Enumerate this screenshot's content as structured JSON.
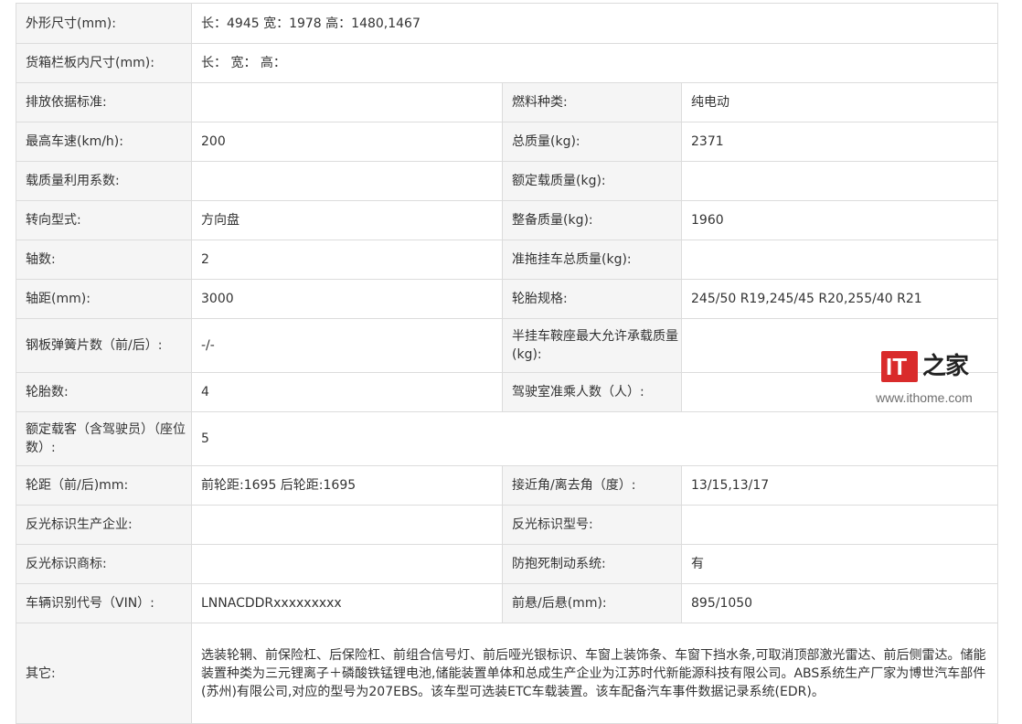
{
  "rows": [
    {
      "l1": "外形尺寸(mm):",
      "v1": "长：4945 宽：1978 高：1480,1467"
    },
    {
      "l1": "货箱栏板内尺寸(mm):",
      "v1": "长： 宽： 高："
    },
    {
      "l1": "排放依据标准:",
      "v1": "",
      "l2": "燃料种类:",
      "v2": "纯电动"
    },
    {
      "l1": "最高车速(km/h):",
      "v1": "200",
      "l2": "总质量(kg):",
      "v2": "2371"
    },
    {
      "l1": "载质量利用系数:",
      "v1": "",
      "l2": "额定载质量(kg):",
      "v2": ""
    },
    {
      "l1": "转向型式:",
      "v1": "方向盘",
      "l2": "整备质量(kg):",
      "v2": "1960"
    },
    {
      "l1": "轴数:",
      "v1": "2",
      "l2": "准拖挂车总质量(kg):",
      "v2": ""
    },
    {
      "l1": "轴距(mm):",
      "v1": "3000",
      "l2": "轮胎规格:",
      "v2": "245/50 R19,245/45 R20,255/40 R21"
    },
    {
      "l1": "钢板弹簧片数（前/后）:",
      "v1": "-/-",
      "l2": "半挂车鞍座最大允许承载质量(kg):",
      "v2": ""
    },
    {
      "l1": "轮胎数:",
      "v1": "4",
      "l2": "驾驶室准乘人数（人）:",
      "v2": ""
    },
    {
      "l1": "额定载客（含驾驶员）（座位数）:",
      "v1": "5"
    },
    {
      "l1": "轮距（前/后)mm:",
      "v1": "前轮距:1695 后轮距:1695",
      "l2": "接近角/离去角（度）:",
      "v2": "13/15,13/17"
    },
    {
      "l1": "反光标识生产企业:",
      "v1": "",
      "l2": "反光标识型号:",
      "v2": ""
    },
    {
      "l1": "反光标识商标:",
      "v1": "",
      "l2": "防抱死制动系统:",
      "v2": "有"
    },
    {
      "l1": "车辆识别代号（VIN）:",
      "v1": "LNNACDDRxxxxxxxxx",
      "l2": "前悬/后悬(mm):",
      "v2": "895/1050"
    },
    {
      "l1": "其它:",
      "v1": "选装轮辋、前保险杠、后保险杠、前组合信号灯、前后哑光银标识、车窗上装饰条、车窗下挡水条,可取消顶部激光雷达、前后侧雷达。储能装置种类为三元锂离子＋磷酸铁锰锂电池,储能装置单体和总成生产企业为江苏时代新能源科技有限公司。ABS系统生产厂家为博世汽车部件(苏州)有限公司,对应的型号为207EBS。该车型可选装ETC车载装置。该车配备汽车事件数据记录系统(EDR)。"
    }
  ],
  "watermark": {
    "logo_text": "IT",
    "logo_subtext": "之家",
    "url": "www.ithome.com"
  }
}
